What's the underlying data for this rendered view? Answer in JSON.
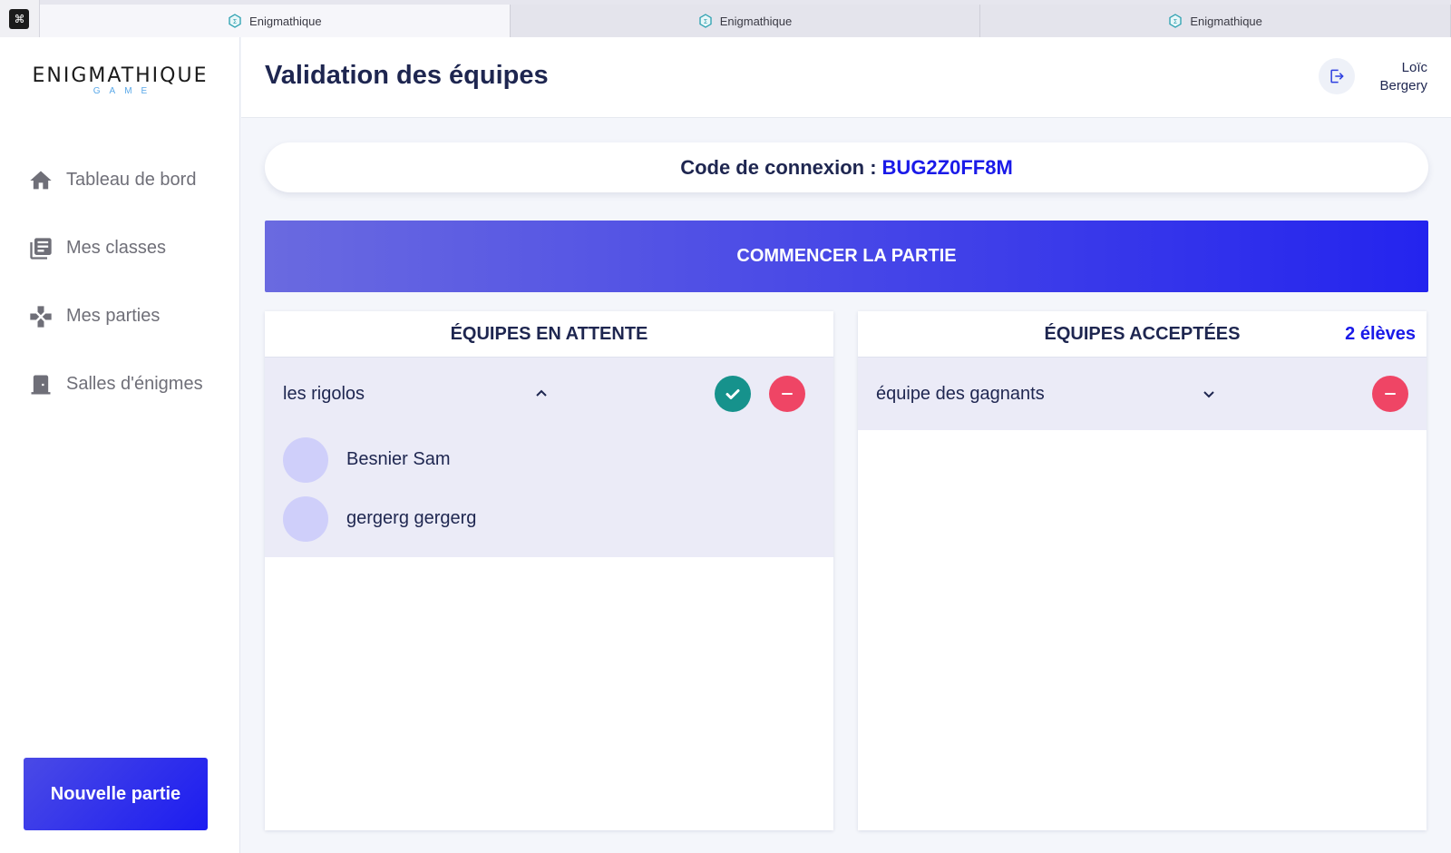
{
  "browser": {
    "tabs": [
      {
        "title": "Enigmathique",
        "active": true
      },
      {
        "title": "Enigmathique",
        "active": false
      },
      {
        "title": "Enigmathique",
        "active": false
      }
    ]
  },
  "sidebar": {
    "logo": {
      "main": "ENIGMATHIQUE",
      "sub": "GAME"
    },
    "items": [
      {
        "label": "Tableau de bord",
        "icon": "home-icon"
      },
      {
        "label": "Mes classes",
        "icon": "library-icon"
      },
      {
        "label": "Mes parties",
        "icon": "gamepad-icon"
      },
      {
        "label": "Salles d'énigmes",
        "icon": "door-icon"
      }
    ],
    "new_game_label": "Nouvelle partie"
  },
  "header": {
    "title": "Validation des équipes",
    "user_first": "Loïc",
    "user_last": "Bergery"
  },
  "connection": {
    "label": "Code de connexion :",
    "code": "BUG2Z0FF8M"
  },
  "start_button_label": "COMMENCER LA PARTIE",
  "pending": {
    "title": "ÉQUIPES EN ATTENTE",
    "teams": [
      {
        "name": "les rigolos",
        "expanded": true,
        "members": [
          "Besnier Sam",
          "gergerg gergerg"
        ]
      }
    ]
  },
  "accepted": {
    "title": "ÉQUIPES ACCEPTÉES",
    "count_label": "2 élèves",
    "teams": [
      {
        "name": "équipe des gagnants",
        "expanded": false
      }
    ]
  },
  "colors": {
    "accent": "#1a1ae8",
    "accept": "#16928c",
    "remove": "#ef4565",
    "avatar": "#cfcffa"
  }
}
